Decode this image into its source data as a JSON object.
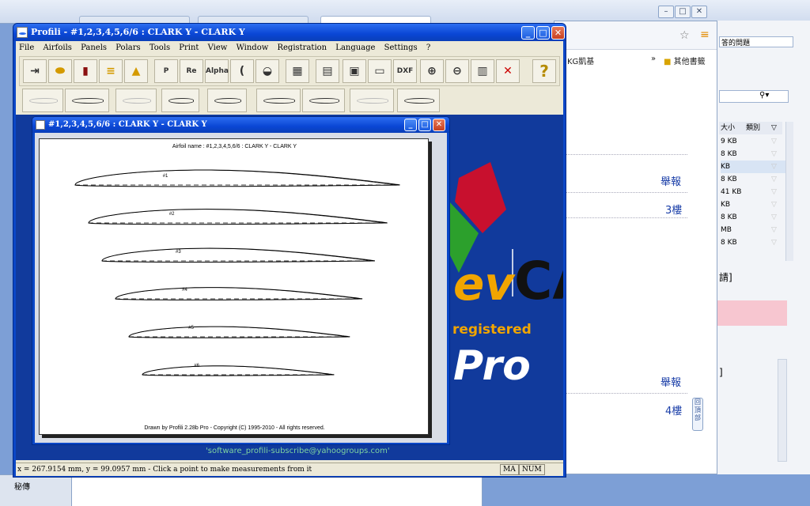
{
  "app": {
    "title": "Profili - #1,2,3,4,5,6/6 : CLARK Y - CLARK Y",
    "menu": [
      "File",
      "Airfoils",
      "Panels",
      "Polars",
      "Tools",
      "Print",
      "View",
      "Window",
      "Registration",
      "Language",
      "Settings",
      "?"
    ],
    "toolbar1_icons": [
      "exit-icon",
      "airfoil-icon",
      "book-icon",
      "stack-icon",
      "tower-icon",
      "cp-icon",
      "re-icon",
      "alpha-icon",
      "curve-icon",
      "fish-icon",
      "panel-icon",
      "calc-icon",
      "monitor-icon",
      "printer-icon",
      "dxf-icon",
      "zoom-in-icon",
      "zoom-out-icon",
      "grid-icon",
      "delete-icon",
      "help-icon"
    ],
    "toolbar1_labels": {
      "cp": "P",
      "re": "Re",
      "alpha": "Alpha",
      "dxf": "DXF",
      "help": "?"
    },
    "toolbar2_icons": [
      "airfoil-outline-icon",
      "airfoil-arrow-icon",
      "airfoil-light-icon",
      "fuselage-icon",
      "rib-icon",
      "flow-icon",
      "airfoil-holes-icon",
      "ribs-plan-icon",
      "plane-icon"
    ]
  },
  "status": {
    "text": "x = 267.9154 mm, y = 99.0957 mm - Click a point to make measurements from it",
    "ma": "MA",
    "num": "NUM"
  },
  "logo": {
    "rev": "ev",
    "ca": "CA",
    "registered": "registered",
    "pro": "Pro",
    "email": "'software_profili-subscribe@yahoogroups.com'"
  },
  "child": {
    "title": "#1,2,3,4,5,6/6 : CLARK Y - CLARK Y",
    "sheet_title": "Airfoil name : #1,2,3,4,5,6/6 : CLARK Y - CLARK Y",
    "footer": "Drawn by Profili 2.28b Pro - Copyright (C) 1995-2010 - All rights reserved.",
    "airfoils": [
      {
        "label": "#1",
        "chord": 1.0
      },
      {
        "label": "#2",
        "chord": 0.92
      },
      {
        "label": "#3",
        "chord": 0.84
      },
      {
        "label": "#4",
        "chord": 0.76
      },
      {
        "label": "#5",
        "chord": 0.68
      },
      {
        "label": "#6",
        "chord": 0.59
      }
    ]
  },
  "browser": {
    "bookmarks1": "KG凱基",
    "bookmarks_more": "»",
    "bookmarks2": "其他書籤",
    "report1": "舉報",
    "floor3": "3樓",
    "report2": "舉報",
    "floor4": "4樓",
    "back_top": "回頂部"
  },
  "panel": {
    "search_text": "答的問題",
    "col_size": "大小",
    "col_type": "類別",
    "sizes": [
      "9 KB",
      "8 KB",
      "KB",
      "8 KB",
      "41 KB",
      "KB",
      "8 KB",
      "MB",
      "8 KB"
    ],
    "bracket1": "請]",
    "bracket2": "]"
  },
  "taskbar": {
    "item": "秘傳"
  }
}
